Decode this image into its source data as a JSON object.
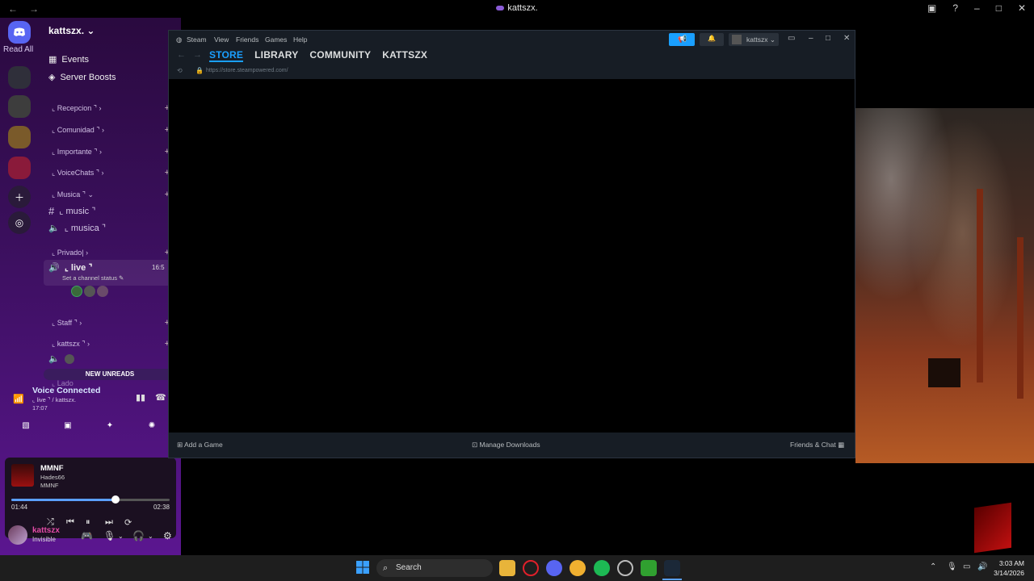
{
  "topbar": {
    "title": "kattszx.",
    "back": "←",
    "forward": "→"
  },
  "discord": {
    "read_all": "Read All",
    "server_name": "kattszx.",
    "events": "Events",
    "server_boosts": "Server Boosts",
    "categories": {
      "recepcion": "⌞ Recepcion ⌝",
      "comunidad": "⌞ Comunidad ⌝",
      "importante": "⌞ Importante ⌝",
      "voicechats": "⌞ VoiceChats ⌝",
      "musica": "⌞ Musica ⌝",
      "privado": "⌞ Privado|",
      "staff": "⌞ Staff ⌝",
      "kattszx": "⌞ kattszx ⌝",
      "lado": "⌞ Lado"
    },
    "channels": {
      "music": "⌞ music ⌝",
      "musica": "⌞ musica ⌝",
      "live": "⌞ live ⌝",
      "live_time": "16:5",
      "live_status": "Set a channel status"
    },
    "new_unreads": "NEW UNREADS",
    "voice": {
      "title": "Voice Connected",
      "sub": "⌞ live ⌝ / kattszx.",
      "time": "17:07"
    },
    "music": {
      "title": "MMNF",
      "artist": "Hades66",
      "album": "MMNF",
      "elapsed": "01:44",
      "total": "02:38",
      "progress": 0.66
    },
    "user": {
      "name": "kattszx",
      "status": "Invisible"
    }
  },
  "steam": {
    "menu": [
      "Steam",
      "View",
      "Friends",
      "Games",
      "Help"
    ],
    "tabs": [
      "STORE",
      "LIBRARY",
      "COMMUNITY",
      "KATTSZX"
    ],
    "url": "https://store.steampowered.com/",
    "account": "kattszx",
    "footer": {
      "add_game": "Add a Game",
      "downloads": "Manage Downloads",
      "friends": "Friends & Chat"
    }
  },
  "taskbar": {
    "search": "Search",
    "time": "3:03 AM",
    "date": "3/14/2026"
  },
  "colors": {
    "steam_accent": "#1a9fff",
    "discord_bg": "#3a0f5c"
  }
}
